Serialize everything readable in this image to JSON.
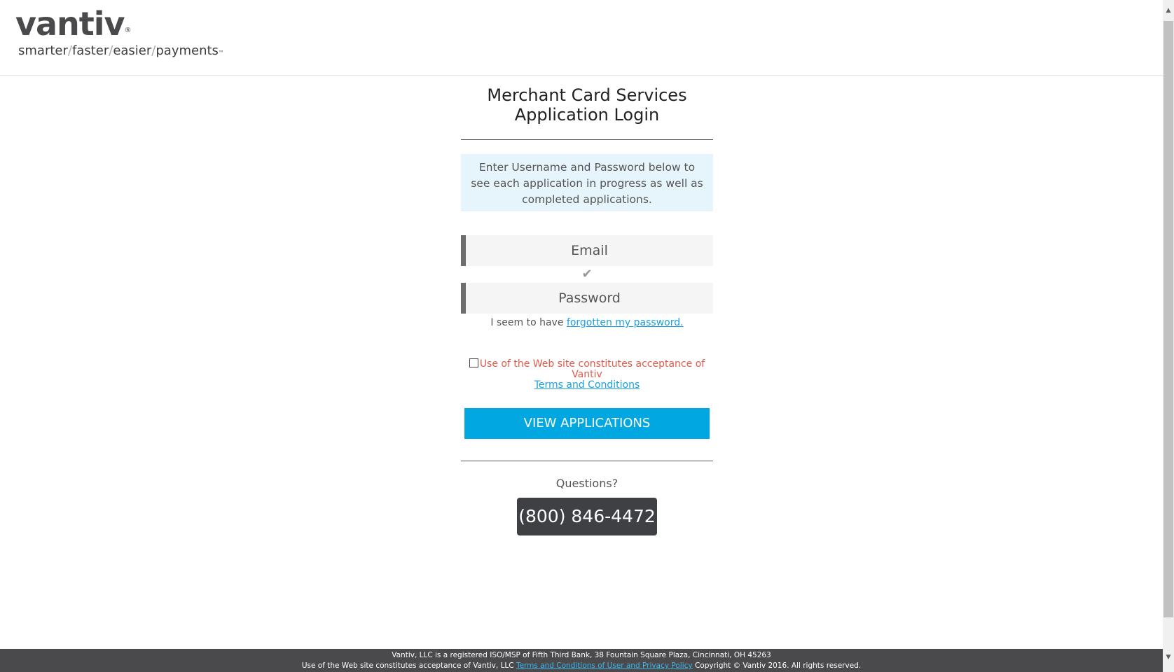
{
  "header": {
    "logo_word": "vantiv",
    "logo_reg": "®",
    "tagline_parts": [
      "smarter",
      "faster",
      "easier",
      "payments"
    ],
    "tagline_sep": "/",
    "tagline_tm": "™"
  },
  "main": {
    "title_line1": "Merchant Card Services",
    "title_line2": "Application Login",
    "info_text": "Enter Username and Password below to see each application in progress as well as completed applications.",
    "email_placeholder": "Email",
    "check_glyph": "✔",
    "password_placeholder": "Password",
    "forgot_prefix": "I seem to have ",
    "forgot_link": "forgotten my password.",
    "terms_text": "Use of the Web site constitutes acceptance of Vantiv",
    "terms_link": "Terms and Conditions",
    "terms_checked": false,
    "button_label": "VIEW APPLICATIONS",
    "questions_label": "Questions?",
    "phone": "(800) 846-4472"
  },
  "footer": {
    "line1": "Vantiv, LLC is a registered ISO/MSP of Fifth Third Bank, 38 Fountain Square Plaza, Cincinnati, OH 45263",
    "line2_prefix": "Use of the Web site constitutes acceptance of Vantiv, LLC ",
    "line2_link": "Terms and Conditions of User and Privacy Policy",
    "line2_suffix": " Copyright © Vantiv 2016. All rights reserved."
  },
  "colors": {
    "accent": "#00a7e1",
    "link": "#1aa0dc",
    "terms_text": "#e05a4b",
    "info_bg": "#e6f4fb",
    "footer_bg": "#4a4a4d",
    "phone_bg": "#3f4044"
  },
  "icons": {
    "checkmark": "checkmark-icon",
    "scroll_up": "scroll-up-arrow-icon",
    "scroll_down": "scroll-down-arrow-icon"
  }
}
